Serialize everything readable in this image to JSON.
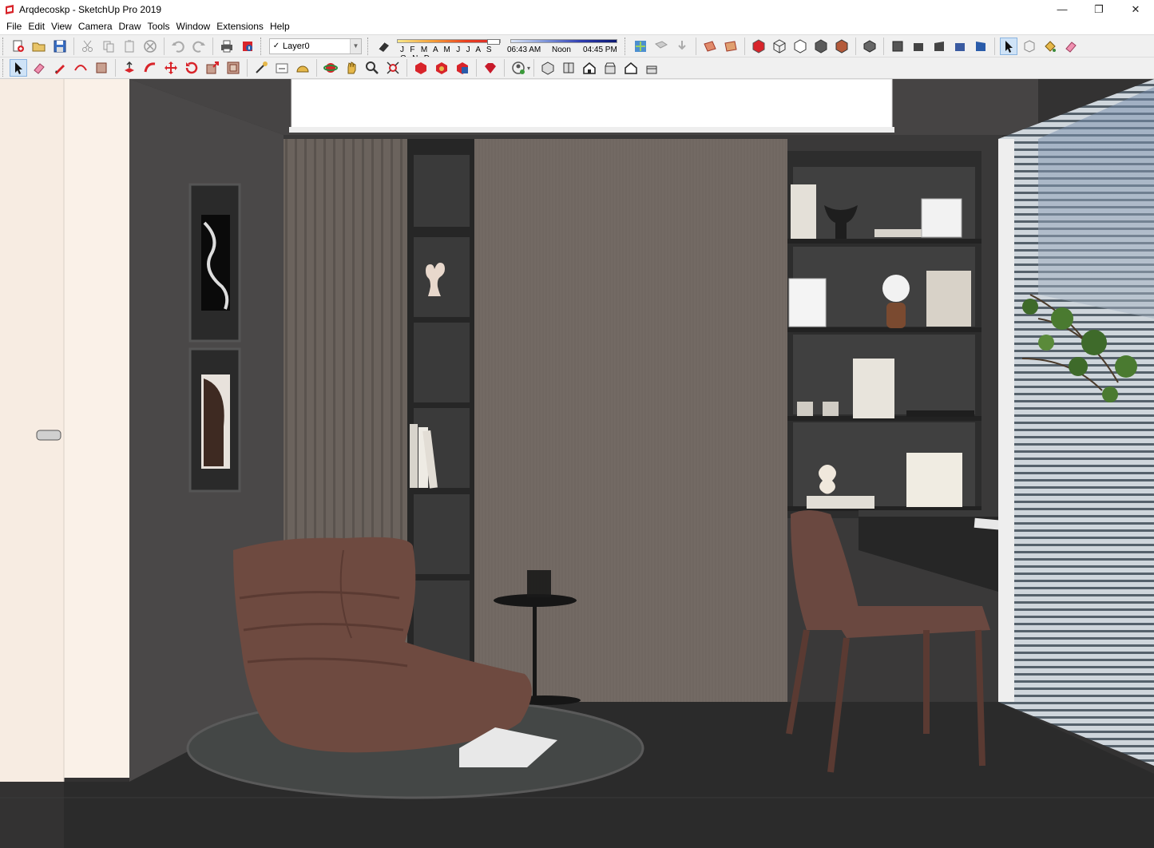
{
  "window": {
    "title": "Arqdecoskp - SketchUp Pro 2019",
    "minimize": "—",
    "maximize": "❐",
    "close": "✕"
  },
  "menu": [
    "File",
    "Edit",
    "View",
    "Camera",
    "Draw",
    "Tools",
    "Window",
    "Extensions",
    "Help"
  ],
  "layer": {
    "current": "Layer0",
    "check": "✓"
  },
  "shadows": {
    "months": "J F M A M J J A S O N D",
    "sunrise": "06:43 AM",
    "noon": "Noon",
    "sunset": "04:45 PM"
  },
  "colors": {
    "accent_active": "#cfe3f7",
    "wall": "#4a4848",
    "panel_wood": "#6f6660",
    "floor": "#2b2b2b",
    "door_frame": "#f8eee4"
  }
}
